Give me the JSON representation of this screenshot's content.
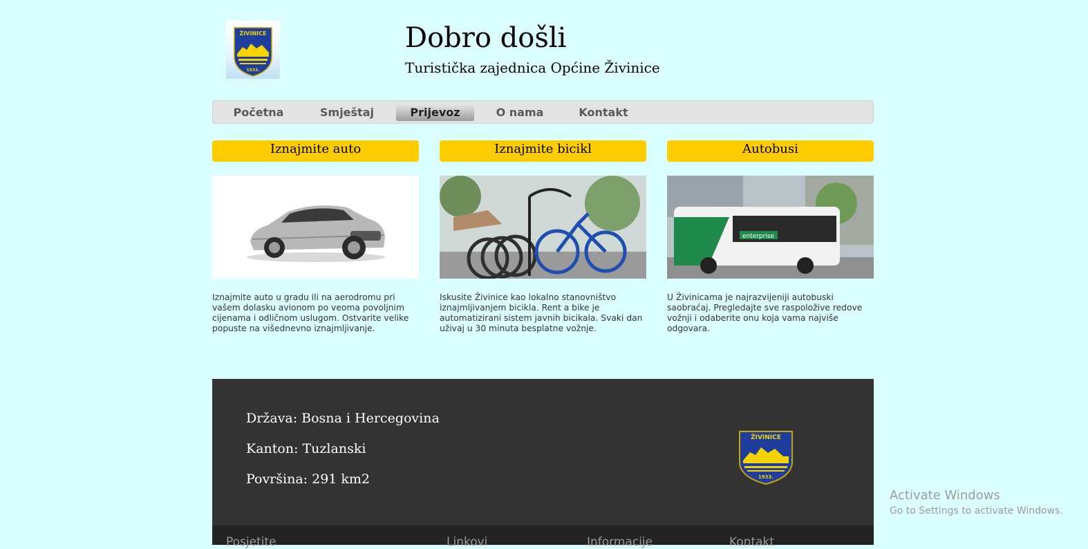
{
  "header": {
    "logo_text": "ŽIVINICE",
    "logo_year": "1933.",
    "title": "Dobro došli",
    "subtitle": "Turistička zajednica Općine Živinice"
  },
  "nav": {
    "items": [
      {
        "label": "Početna",
        "active": false
      },
      {
        "label": "Smještaj",
        "active": false
      },
      {
        "label": "Prijevoz",
        "active": true
      },
      {
        "label": "O nama",
        "active": false
      },
      {
        "label": "Kontakt",
        "active": false
      }
    ]
  },
  "cards": [
    {
      "title": "Iznajmite auto",
      "text": "Iznajmite auto u gradu ili na aerodromu pri vašem dolasku avionom po veoma povoljnim cijenama i odličnom uslugom. Ostvarite velike popuste na višednevno iznajmljivanje."
    },
    {
      "title": "Iznajmite bicikl",
      "text": "Iskusite Živinice kao lokalno stanovništvo iznajmljivanjem bicikla. Rent a bike je automatizirani sistem javnih bicikala. Svaki dan uživaj u 30 minuta besplatne vožnje."
    },
    {
      "title": "Autobusi",
      "text": "U Živinicama je najrazvijeniji autobuski saobraćaj. Pregledajte sve raspoložive redove vožnji i odaberite onu koja vama najviše odgovara.",
      "bus_brand": "enterprise"
    }
  ],
  "footer": {
    "lines": [
      "Država: Bosna i Hercegovina",
      "Kanton: Tuzlanski",
      "Površina: 291 km2"
    ],
    "bottom_partial": [
      "Posjetite",
      "Linkovi",
      "Informacije",
      "Kontakt"
    ]
  },
  "watermark": {
    "title": "Activate Windows",
    "subtitle": "Go to Settings to activate Windows."
  },
  "colors": {
    "page_bg": "#dbfefe",
    "card_title_bg": "#ffcc00",
    "footer_bg": "#333333",
    "crest_blue": "#1f3d9c",
    "crest_yellow": "#f5d300"
  }
}
